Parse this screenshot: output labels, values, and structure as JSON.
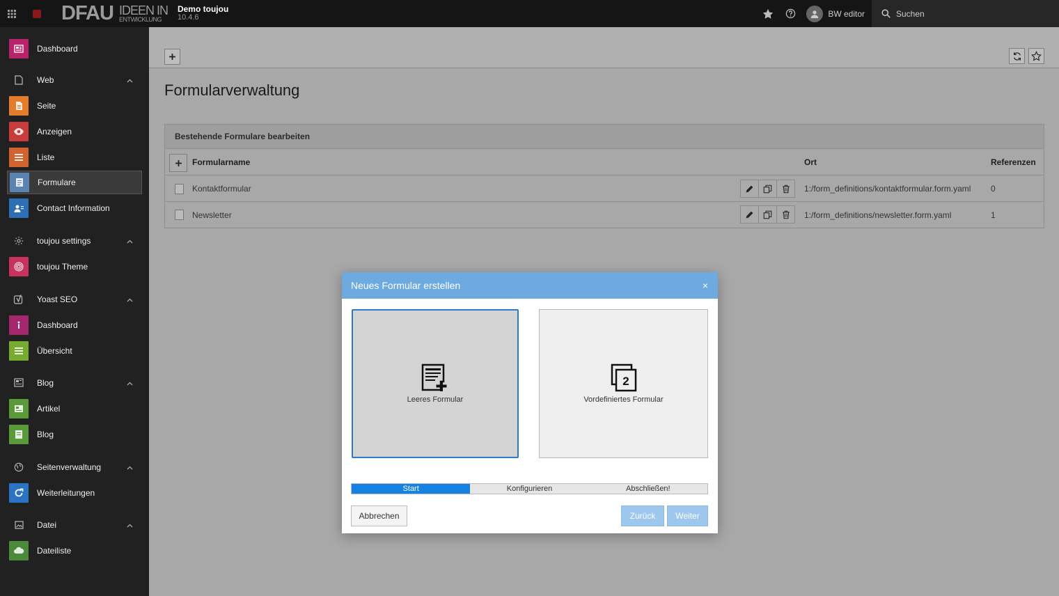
{
  "topbar": {
    "logo_big": "DFAU",
    "logo_small_1": "IDEEN IN",
    "logo_small_2": "ENTWICKLUNG",
    "site_name": "Demo toujou",
    "site_version": "10.4.6",
    "user": "BW editor",
    "search_label": "Suchen"
  },
  "sidebar": {
    "dashboard": "Dashboard",
    "groups": {
      "web": "Web",
      "toujou": "toujou settings",
      "yoast": "Yoast SEO",
      "blog": "Blog",
      "seiten": "Seitenverwaltung",
      "datei": "Datei"
    },
    "items": {
      "seite": "Seite",
      "anzeigen": "Anzeigen",
      "liste": "Liste",
      "formulare": "Formulare",
      "contact": "Contact Information",
      "theme": "toujou Theme",
      "ydashboard": "Dashboard",
      "uebersicht": "Übersicht",
      "artikel": "Artikel",
      "blog": "Blog",
      "weiterleitungen": "Weiterleitungen",
      "dateiliste": "Dateiliste"
    },
    "colors": {
      "dashboard": "#b8246b",
      "seite": "#e37d2b",
      "anzeigen": "#c83c3c",
      "liste": "#d0632e",
      "formulare": "#5b83b2",
      "contact": "#2c6fb5",
      "theme": "#c8325c",
      "ydashboard": "#a4276e",
      "uebersicht": "#77ab2f",
      "artikel": "#5a9a3a",
      "blog": "#5a9a3a",
      "weiterleitungen": "#2b74c4",
      "dateiliste": "#4a8a3a"
    }
  },
  "main": {
    "title": "Formularverwaltung",
    "panel_title": "Bestehende Formulare bearbeiten",
    "columns": {
      "name": "Formularname",
      "ort": "Ort",
      "ref": "Referenzen"
    },
    "rows": [
      {
        "name": "Kontaktformular",
        "ort": "1:/form_definitions/kontaktformular.form.yaml",
        "ref": "0"
      },
      {
        "name": "Newsletter",
        "ort": "1:/form_definitions/newsletter.form.yaml",
        "ref": "1"
      }
    ]
  },
  "modal": {
    "title": "Neues Formular erstellen",
    "close": "×",
    "choice_blank": "Leeres Formular",
    "choice_predefined": "Vordefiniertes Formular",
    "steps": [
      "Start",
      "Konfigurieren",
      "Abschließen!"
    ],
    "cancel": "Abbrechen",
    "back": "Zurück",
    "next": "Weiter"
  }
}
